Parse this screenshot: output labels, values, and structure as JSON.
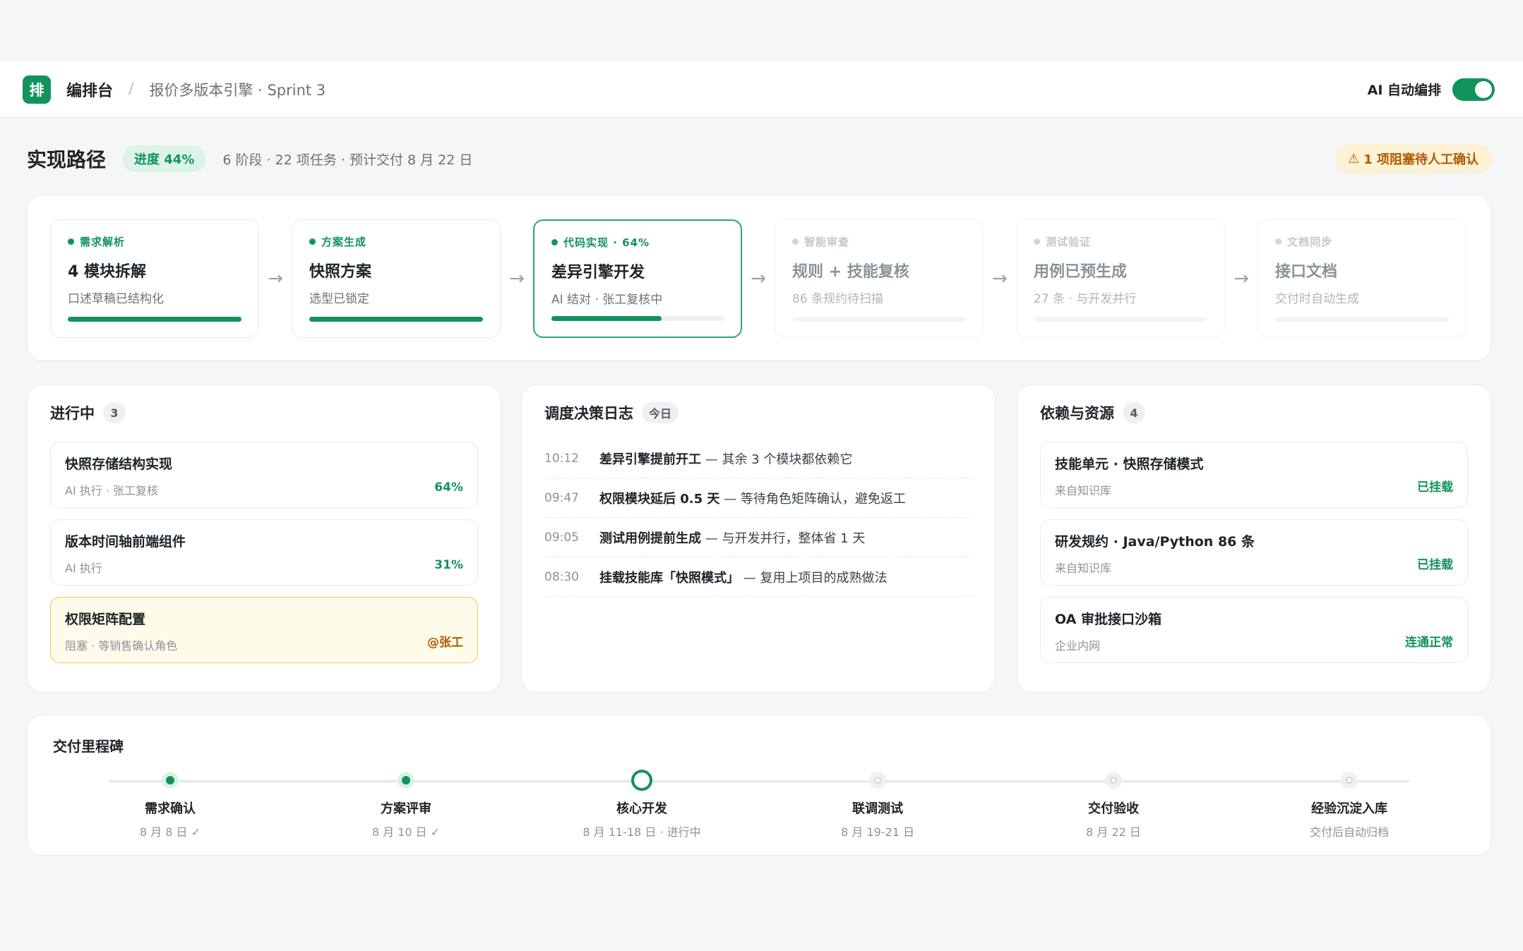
{
  "topbar": {
    "logo_glyph": "排",
    "app_name": "编排台",
    "separator": "/",
    "breadcrumb": "报价多版本引擎 · Sprint 3",
    "auto_label": "AI 自动编排",
    "auto_enabled": true
  },
  "path": {
    "title": "实现路径",
    "progress_label": "进度 44%",
    "meta": "6 阶段 · 22 项任务 · 预计交付 8 月 22 日",
    "warning": "1 项阻塞待人工确认",
    "warning_icon": "warning-icon"
  },
  "stages": [
    {
      "label": "需求解析",
      "title": "4 模块拆解",
      "sub": "口述草稿已结构化",
      "progress": 1.0,
      "state": "done"
    },
    {
      "label": "方案生成",
      "title": "快照方案",
      "sub": "选型已锁定",
      "progress": 1.0,
      "state": "done"
    },
    {
      "label": "代码实现 · 64%",
      "title": "差异引擎开发",
      "sub": "AI 结对 · 张工复核中",
      "progress": 0.64,
      "state": "active"
    },
    {
      "label": "智能审查",
      "title": "规则 + 技能复核",
      "sub": "86 条规约待扫描",
      "progress": 0,
      "state": "future"
    },
    {
      "label": "测试验证",
      "title": "用例已预生成",
      "sub": "27 条 · 与开发并行",
      "progress": 0,
      "state": "future"
    },
    {
      "label": "文档同步",
      "title": "接口文档",
      "sub": "交付时自动生成",
      "progress": 0,
      "state": "future"
    }
  ],
  "stage_arrow": "→",
  "inprogress": {
    "title": "进行中",
    "count": "3",
    "tasks": [
      {
        "title": "快照存储结构实现",
        "sub": "AI 执行 · 张工复核",
        "value": "64%",
        "blocked": false
      },
      {
        "title": "版本时间轴前端组件",
        "sub": "AI 执行",
        "value": "31%",
        "blocked": false
      },
      {
        "title": "权限矩阵配置",
        "sub": "阻塞 · 等销售确认角色",
        "value": "@张工",
        "blocked": true
      }
    ]
  },
  "logs": {
    "title": "调度决策日志",
    "badge": "今日",
    "entries": [
      {
        "time": "10:12",
        "head": "差异引擎提前开工",
        "rest": " — 其余 3 个模块都依赖它"
      },
      {
        "time": "09:47",
        "head": "权限模块延后 0.5 天",
        "rest": " — 等待角色矩阵确认，避免返工"
      },
      {
        "time": "09:05",
        "head": "测试用例提前生成",
        "rest": " — 与开发并行，整体省 1 天"
      },
      {
        "time": "08:30",
        "head": "挂载技能库「快照模式」",
        "rest": " — 复用上项目的成熟做法"
      }
    ]
  },
  "deps": {
    "title": "依赖与资源",
    "count": "4",
    "items": [
      {
        "title": "技能单元 · 快照存储模式",
        "sub": "来自知识库",
        "value": "已挂载"
      },
      {
        "title": "研发规约 · Java/Python 86 条",
        "sub": "来自知识库",
        "value": "已挂载"
      },
      {
        "title": "OA 审批接口沙箱",
        "sub": "企业内网",
        "value": "连通正常"
      }
    ]
  },
  "milestones": {
    "title": "交付里程碑",
    "items": [
      {
        "name": "需求确认",
        "date": "8 月 8 日 ✓",
        "state": "done"
      },
      {
        "name": "方案评审",
        "date": "8 月 10 日 ✓",
        "state": "done"
      },
      {
        "name": "核心开发",
        "date": "8 月 11-18 日 · 进行中",
        "state": "current"
      },
      {
        "name": "联调测试",
        "date": "8 月 19-21 日",
        "state": "todo"
      },
      {
        "name": "交付验收",
        "date": "8 月 22 日",
        "state": "todo"
      },
      {
        "name": "经验沉淀入库",
        "date": "交付后自动归档",
        "state": "todo"
      }
    ]
  },
  "colors": {
    "accent": "#12935c",
    "warning": "#b05a00",
    "blocked_bg": "#fffbea"
  }
}
